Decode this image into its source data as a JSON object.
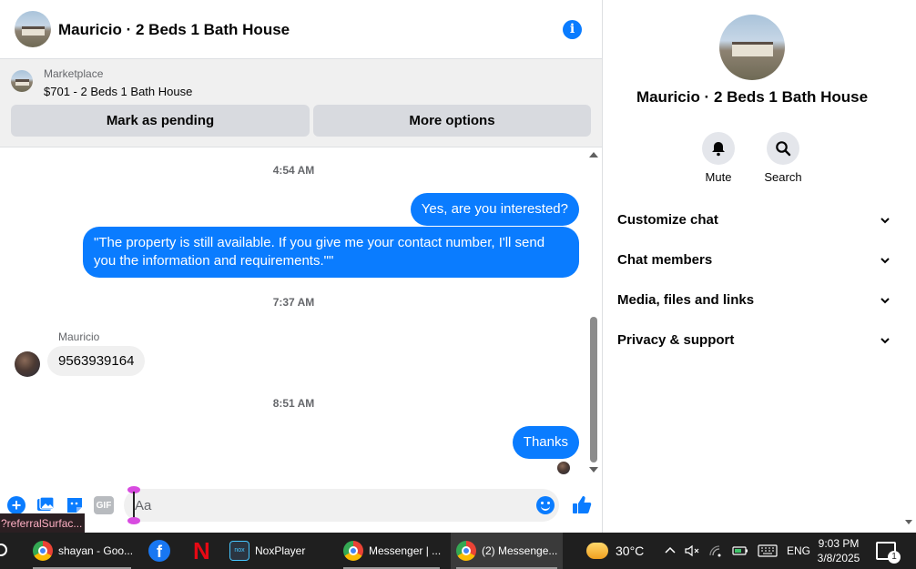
{
  "header": {
    "title": "Mauricio · 2 Beds 1 Bath House"
  },
  "marketplace": {
    "label": "Marketplace",
    "item": "$701 - 2 Beds 1 Bath House",
    "pending_button": "Mark as pending",
    "more_button": "More options"
  },
  "messages": {
    "time1": "4:54 AM",
    "out1": "Yes, are you interested?",
    "out2": "\"The property is still available. If you give me your contact number, I'll send you the information and requirements.\"\"",
    "time2": "7:37 AM",
    "sender": "Mauricio",
    "in1": "9563939164",
    "time3": "8:51 AM",
    "out3": "Thanks"
  },
  "composer": {
    "placeholder": "Aa",
    "gif_label": "GIF"
  },
  "tooltip": "?referralSurfac...",
  "info": {
    "title": "Mauricio · 2 Beds 1 Bath House",
    "mute_label": "Mute",
    "search_label": "Search",
    "sections": [
      "Customize chat",
      "Chat members",
      "Media, files and links",
      "Privacy & support"
    ]
  },
  "taskbar": {
    "items": [
      "shayan - Goo...",
      "NoxPlayer",
      "Messenger | ...",
      "(2) Messenge..."
    ],
    "weather": "30°C",
    "language": "ENG",
    "time": "9:03 PM",
    "date": "3/8/2025",
    "notifications": "1"
  },
  "colors": {
    "accent": "#0a7cff",
    "bubble_in": "#f0f0f0",
    "taskbar": "#1f1f1f"
  }
}
